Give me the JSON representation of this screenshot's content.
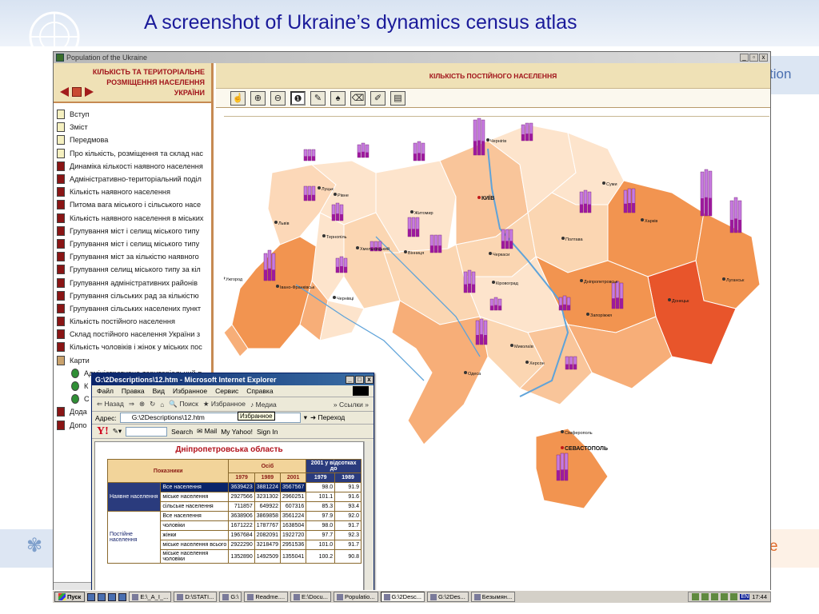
{
  "slide": {
    "title": "A screenshot of Ukraine’s dynamics census atlas",
    "right_fragment_top": "tion",
    "right_fragment_bottom": "e"
  },
  "app": {
    "title": "Population of the Ukraine",
    "left_header": "КІЛЬКІСТЬ ТА ТЕРИТОРІАЛЬНЕ\nРОЗМІЩЕННЯ НАСЕЛЕННЯ\nУКРАЇНИ",
    "nav_items": [
      {
        "label": "Вступ",
        "icon": "doc"
      },
      {
        "label": "Зміст",
        "icon": "doc"
      },
      {
        "label": "Передмова",
        "icon": "doc"
      },
      {
        "label": "Про кількість, розміщення та склад нас",
        "icon": "doc"
      },
      {
        "label": "Динаміка кількості наявного населення",
        "icon": "book"
      },
      {
        "label": "Адміністративно-територіальний поділ",
        "icon": "book"
      },
      {
        "label": "Кількість наявного населення",
        "icon": "book"
      },
      {
        "label": "Питома вага міського і сільського насе",
        "icon": "book"
      },
      {
        "label": "Кількість наявного населення в міських",
        "icon": "book"
      },
      {
        "label": "Групування міст і селищ міського типу",
        "icon": "book"
      },
      {
        "label": "Групування міст і селищ міського типу",
        "icon": "book"
      },
      {
        "label": "Групування міст за кількістю наявного",
        "icon": "book"
      },
      {
        "label": "Групування селищ міського типу за кіл",
        "icon": "book"
      },
      {
        "label": "Групування адміністративних районів",
        "icon": "book"
      },
      {
        "label": "Групування сільських рад за кількістю",
        "icon": "book"
      },
      {
        "label": "Групування сільських населених пункт",
        "icon": "book"
      },
      {
        "label": "Кількість постійного населення",
        "icon": "book"
      },
      {
        "label": "Склад постійного населення України з",
        "icon": "book"
      },
      {
        "label": "Кількість чоловіків і жінок у міських пос",
        "icon": "book"
      },
      {
        "label": "Карти",
        "icon": "folder"
      },
      {
        "label": "Адміністративно-територіальний п",
        "icon": "sub"
      },
      {
        "label": "К",
        "icon": "sub"
      },
      {
        "label": "С",
        "icon": "sub"
      },
      {
        "label": "Дода",
        "icon": "book"
      },
      {
        "label": "Допо",
        "icon": "book"
      }
    ],
    "map_header": "КІЛЬКІСТЬ ПОСТІЙНОГО НАСЕЛЕННЯ",
    "tools": [
      {
        "name": "pan",
        "glyph": "☝"
      },
      {
        "name": "zoom-in",
        "glyph": "⊕"
      },
      {
        "name": "zoom-out",
        "glyph": "⊖"
      },
      {
        "name": "info",
        "glyph": "❶"
      },
      {
        "name": "select",
        "glyph": "✎"
      },
      {
        "name": "find",
        "glyph": "♠"
      },
      {
        "name": "clear",
        "glyph": "⌫"
      },
      {
        "name": "measure",
        "glyph": "✐"
      },
      {
        "name": "legend",
        "glyph": "▤"
      }
    ],
    "cities": [
      "Луцьк",
      "Рівне",
      "Житомир",
      "КИЇВ",
      "Чернігів",
      "Суми",
      "Львів",
      "Тернопіль",
      "Хмельницький",
      "Вінниця",
      "Черкаси",
      "Полтава",
      "Харків",
      "Ужгород",
      "Івано-Франківськ",
      "Чернівці",
      "Кіровоград",
      "Дніпропетровськ",
      "Донецьк",
      "Луганськ",
      "Запоріжжя",
      "Одеса",
      "Миколаїв",
      "Херсон",
      "Сімферополь",
      "СЕВАСТОПОЛЬ"
    ]
  },
  "ie": {
    "title": "G:\\2Descriptions\\12.htm - Microsoft Internet Explorer",
    "menu": [
      "Файл",
      "Правка",
      "Вид",
      "Избранное",
      "Сервис",
      "Справка"
    ],
    "toolbar": [
      "Назад",
      "Поиск",
      "Избранное",
      "Медиа"
    ],
    "links_label": "Ссылки",
    "tooltip": "Избранное",
    "address_label": "Адрес:",
    "address": "G:\\2Descriptions\\12.htm",
    "go_label": "Переход",
    "yahoo": {
      "search": "Search",
      "mail": "Mail",
      "my": "My Yahoo!",
      "signin": "Sign In"
    },
    "doc_title": "Дніпропетровська область",
    "table": {
      "col_indicators": "Показники",
      "col_persons": "Осіб",
      "col_pct": "2001 у відсотках до",
      "years": [
        "1979",
        "1989",
        "2001"
      ],
      "pct_years": [
        "1979",
        "1989"
      ],
      "groups": [
        {
          "name": "Наявне населення",
          "rows": [
            {
              "sub": "",
              "label": "Все населення",
              "values": [
                "3639423",
                "3881224",
                "3567567",
                "98.0",
                "91.9"
              ]
            },
            {
              "sub": "",
              "label": "міське населення",
              "values": [
                "2927566",
                "3231302",
                "2960251",
                "101.1",
                "91.6"
              ]
            },
            {
              "sub": "",
              "label": "сільське населення",
              "values": [
                "711857",
                "649922",
                "607316",
                "85.3",
                "93.4"
              ]
            }
          ]
        },
        {
          "name": "Постійне населення",
          "rows": [
            {
              "sub": "",
              "label": "Все населення",
              "values": [
                "3638906",
                "3869858",
                "3561224",
                "97.9",
                "92.0"
              ]
            },
            {
              "sub": "",
              "label": "чоловіки",
              "values": [
                "1671222",
                "1787767",
                "1638504",
                "98.0",
                "91.7"
              ]
            },
            {
              "sub": "",
              "label": "жінки",
              "values": [
                "1967684",
                "2082091",
                "1922720",
                "97.7",
                "92.3"
              ]
            },
            {
              "sub": "міське населення",
              "label": "всього",
              "values": [
                "2922290",
                "3218479",
                "2951536",
                "101.0",
                "91.7"
              ]
            },
            {
              "sub": "міське населення",
              "label": "чоловіки",
              "values": [
                "1352890",
                "1492509",
                "1355041",
                "100.2",
                "90.8"
              ]
            }
          ]
        }
      ]
    }
  },
  "taskbar": {
    "start": "Пуск",
    "tasks": [
      "E:\\_A_I_...",
      "D:\\STATI...",
      "G:\\",
      "Readme....",
      "E:\\Docu...",
      "Populatio...",
      "G:\\2Desc...",
      "G:\\2Des...",
      "Безымян..."
    ],
    "active_index": 6,
    "lang": "EN",
    "clock": "17:44"
  }
}
